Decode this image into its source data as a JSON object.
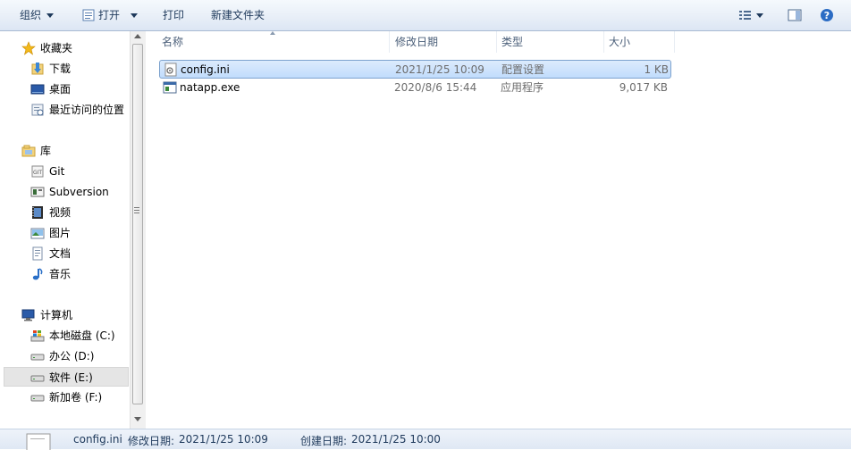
{
  "toolbar": {
    "organize": "组织",
    "open": "打开",
    "print": "打印",
    "new_folder": "新建文件夹"
  },
  "nav": {
    "favorites": "收藏夹",
    "downloads": "下载",
    "desktop": "桌面",
    "recent": "最近访问的位置",
    "libraries": "库",
    "git": "Git",
    "subversion": "Subversion",
    "videos": "视频",
    "pictures": "图片",
    "documents": "文档",
    "music": "音乐",
    "computer": "计算机",
    "drive_c": "本地磁盘 (C:)",
    "drive_d": "办公 (D:)",
    "drive_e": "软件 (E:)",
    "drive_f": "新加卷 (F:)"
  },
  "columns": {
    "name": "名称",
    "modified": "修改日期",
    "type": "类型",
    "size": "大小"
  },
  "files": [
    {
      "name": "config.ini",
      "modified": "2021/1/25 10:09",
      "type": "配置设置",
      "size": "1 KB"
    },
    {
      "name": "natapp.exe",
      "modified": "2020/8/6 15:44",
      "type": "应用程序",
      "size": "9,017 KB"
    }
  ],
  "status": {
    "name": "config.ini",
    "modified_label": "修改日期:",
    "modified": "2021/1/25 10:09",
    "created_label": "创建日期:",
    "created": "2021/1/25 10:00"
  },
  "colors": {
    "accent": "#1e395b",
    "selection": "#c1dcfc",
    "help": "#2b6cc4"
  }
}
